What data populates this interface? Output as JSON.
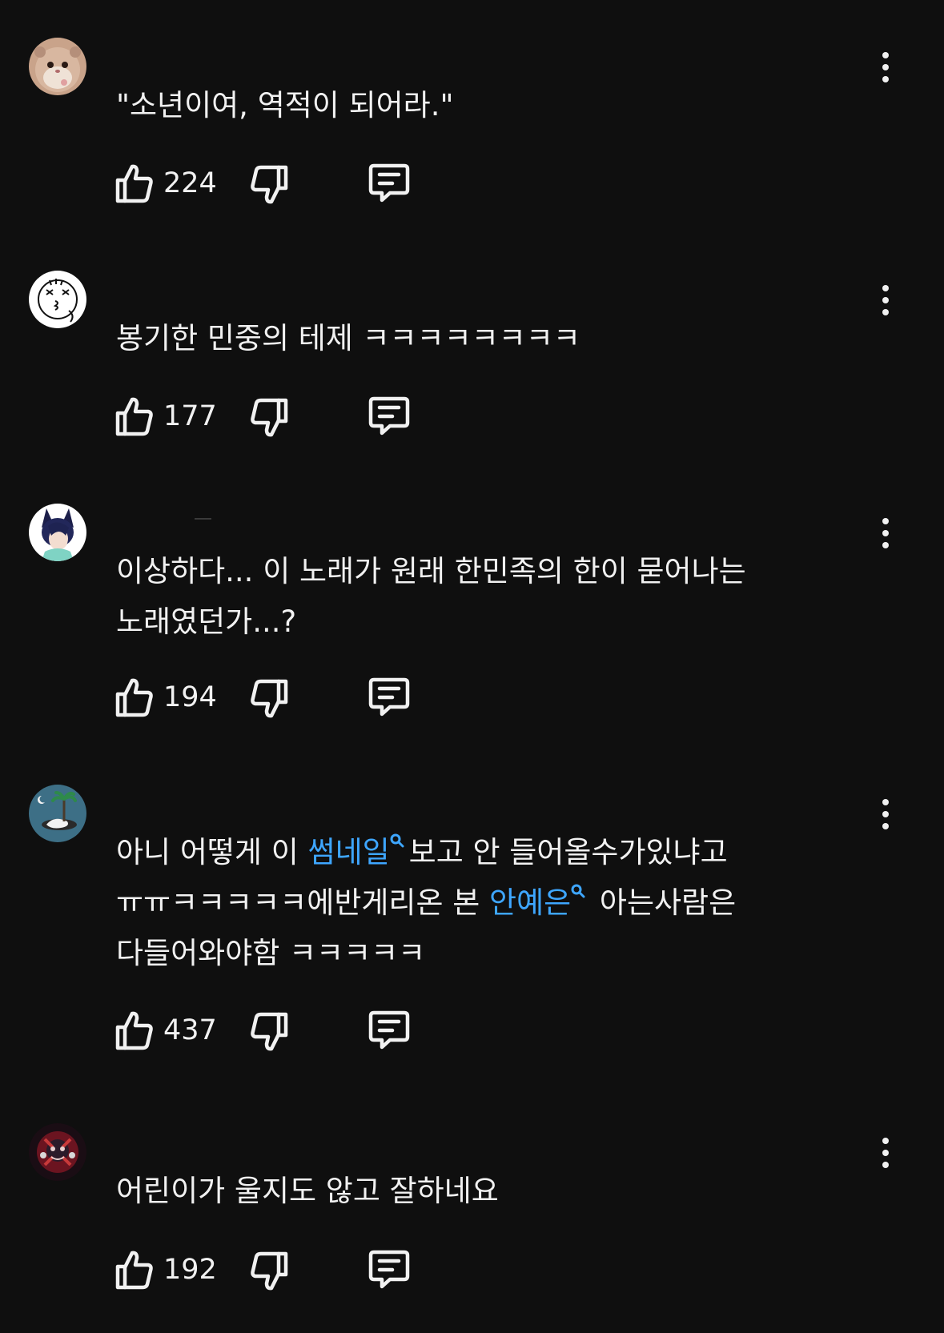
{
  "comments": [
    {
      "avatar": "hamster-avatar",
      "segments": [
        {
          "type": "text",
          "text": "\"소년이여, 역적이 되어라.\""
        }
      ],
      "likes": "224"
    },
    {
      "avatar": "sketch-face-avatar",
      "segments": [
        {
          "type": "text",
          "text": "봉기한 민중의 테제 ㅋㅋㅋㅋㅋㅋㅋㅋ"
        }
      ],
      "likes": "177"
    },
    {
      "avatar": "anime-character-avatar",
      "segments": [
        {
          "type": "text",
          "text": "이상하다... 이 노래가 원래 한민족의 한이 묻어나는 노래였던가...?"
        }
      ],
      "likes": "194"
    },
    {
      "avatar": "island-night-avatar",
      "segments": [
        {
          "type": "text",
          "text": "아니 어떻게 이 "
        },
        {
          "type": "link",
          "text": "썸네일"
        },
        {
          "type": "text",
          "text": "보고 안 들어올수가있냐고 ㅠㅠㅋㅋㅋㅋㅋ에반게리온 본 "
        },
        {
          "type": "link",
          "text": "안예은"
        },
        {
          "type": "text",
          "text": " 아는사람은 다들어와야함 ㅋㅋㅋㅋㅋ"
        }
      ],
      "likes": "437"
    },
    {
      "avatar": "dark-artwork-avatar",
      "segments": [
        {
          "type": "text",
          "text": "어린이가 울지도 않고 잘하네요"
        }
      ],
      "likes": "192"
    }
  ],
  "icons": {
    "like": "thumbs-up-icon",
    "dislike": "thumbs-down-icon",
    "reply": "reply-icon",
    "more": "more-vert-icon",
    "link_search": "search-icon"
  },
  "colors": {
    "background": "#0f0f0f",
    "text": "#f1f1f1",
    "link": "#3ea6ff"
  }
}
